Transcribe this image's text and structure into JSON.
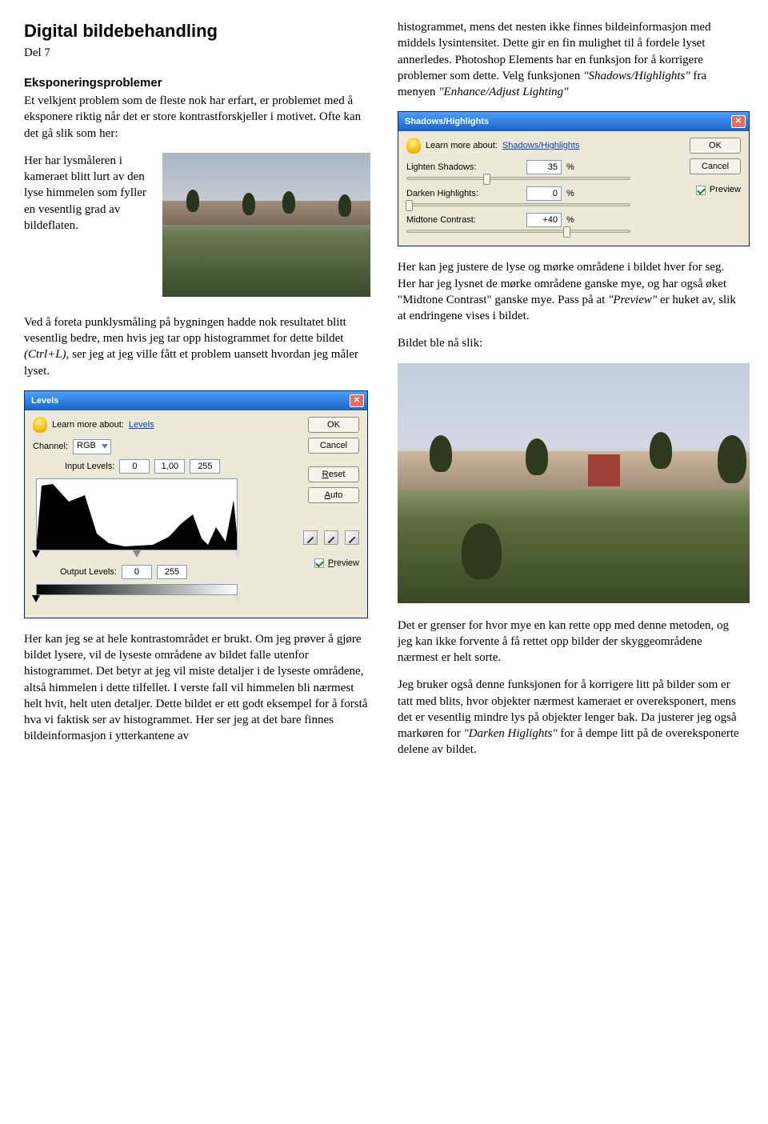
{
  "title": "Digital bildebehandling",
  "subtitle": "Del 7",
  "heading_left": "Eksponeringsproblemer",
  "p1a": "Et velkjent problem som de fleste nok har erfart, er problemet med å eksponere riktig når det er store kontrastforskjeller i motivet. Ofte kan det gå slik som her:",
  "p1b": "Her har lysmåleren i kameraet blitt lurt av den lyse himmelen som fyller en vesentlig grad av bildeflaten.",
  "p2": "Ved å foreta punklysmåling på bygningen hadde nok resultatet blitt vesentlig bedre, men hvis jeg tar opp histogrammet for dette bildet ",
  "p2i": "(Ctrl+L)",
  "p2b": ", ser jeg at jeg ville fått et problem uansett hvordan jeg måler lyset.",
  "p3": "Her kan jeg se at hele kontrastområdet er brukt. Om jeg prøver å gjøre bildet lysere, vil de lyseste områdene av bildet falle utenfor histogrammet. Det betyr at jeg vil miste detaljer i de lyseste områdene, altså himmelen i dette tilfellet. I verste fall vil himmelen bli nærmest helt hvit, helt uten detaljer. Dette bildet er ett godt eksempel for å forstå hva vi faktisk ser av histogrammet. Her ser jeg at det bare finnes bildeinformasjon i ytterkantene av",
  "r1": "histogrammet, mens det nesten ikke finnes bildeinformasjon med middels lysintensitet. Dette gir en fin mulighet til å fordele lyset annerledes. Photoshop Elements har en funksjon for å korrigere problemer som dette. Velg funksjonen ",
  "r1i1": "\"Shadows/Highlights\"",
  "r1m": " fra menyen ",
  "r1i2": "\"Enhance/Adjust Lighting\"",
  "r2a": "Her kan jeg justere de lyse og mørke områdene i bildet hver for seg. Her har jeg lysnet de mørke områdene ganske mye, og har også øket \"Midtone Contrast\" ganske mye. Pass på at ",
  "r2i": "\"Preview\"",
  "r2b": " er huket av, slik at endringene vises i bildet.",
  "r3": "Bildet ble nå slik:",
  "r4": "Det er grenser for hvor mye en kan rette opp med denne metoden, og jeg kan ikke forvente å få rettet opp bilder der skyggeområdene nærmest er helt sorte.",
  "r5a": "Jeg bruker også denne funksjonen for å korrigere litt på bilder som er tatt med blits, hvor objekter nærmest kameraet er overeksponert, mens det er vesentlig mindre lys på objekter lenger bak. Da justerer jeg også markøren for ",
  "r5i": "\"Darken Higlights\"",
  "r5b": " for å dempe litt på de overeksponerte delene av bildet.",
  "levels": {
    "title": "Levels",
    "tip": "Learn more about:",
    "tip_link": "Levels",
    "ok": "OK",
    "cancel": "Cancel",
    "reset": "Reset",
    "auto": "Auto",
    "preview": "Preview",
    "channel_label": "Channel:",
    "channel_value": "RGB",
    "input_label": "Input Levels:",
    "in_b": "0",
    "in_g": "1,00",
    "in_w": "255",
    "output_label": "Output Levels:",
    "out_b": "0",
    "out_w": "255"
  },
  "sh": {
    "title": "Shadows/Highlights",
    "tip": "Learn more about:",
    "tip_link": "Shadows/Highlights",
    "ok": "OK",
    "cancel": "Cancel",
    "preview": "Preview",
    "l1": "Lighten Shadows:",
    "v1": "35",
    "l2": "Darken Highlights:",
    "v2": "0",
    "l3": "Midtone Contrast:",
    "v3": "+40",
    "pct": "%"
  }
}
